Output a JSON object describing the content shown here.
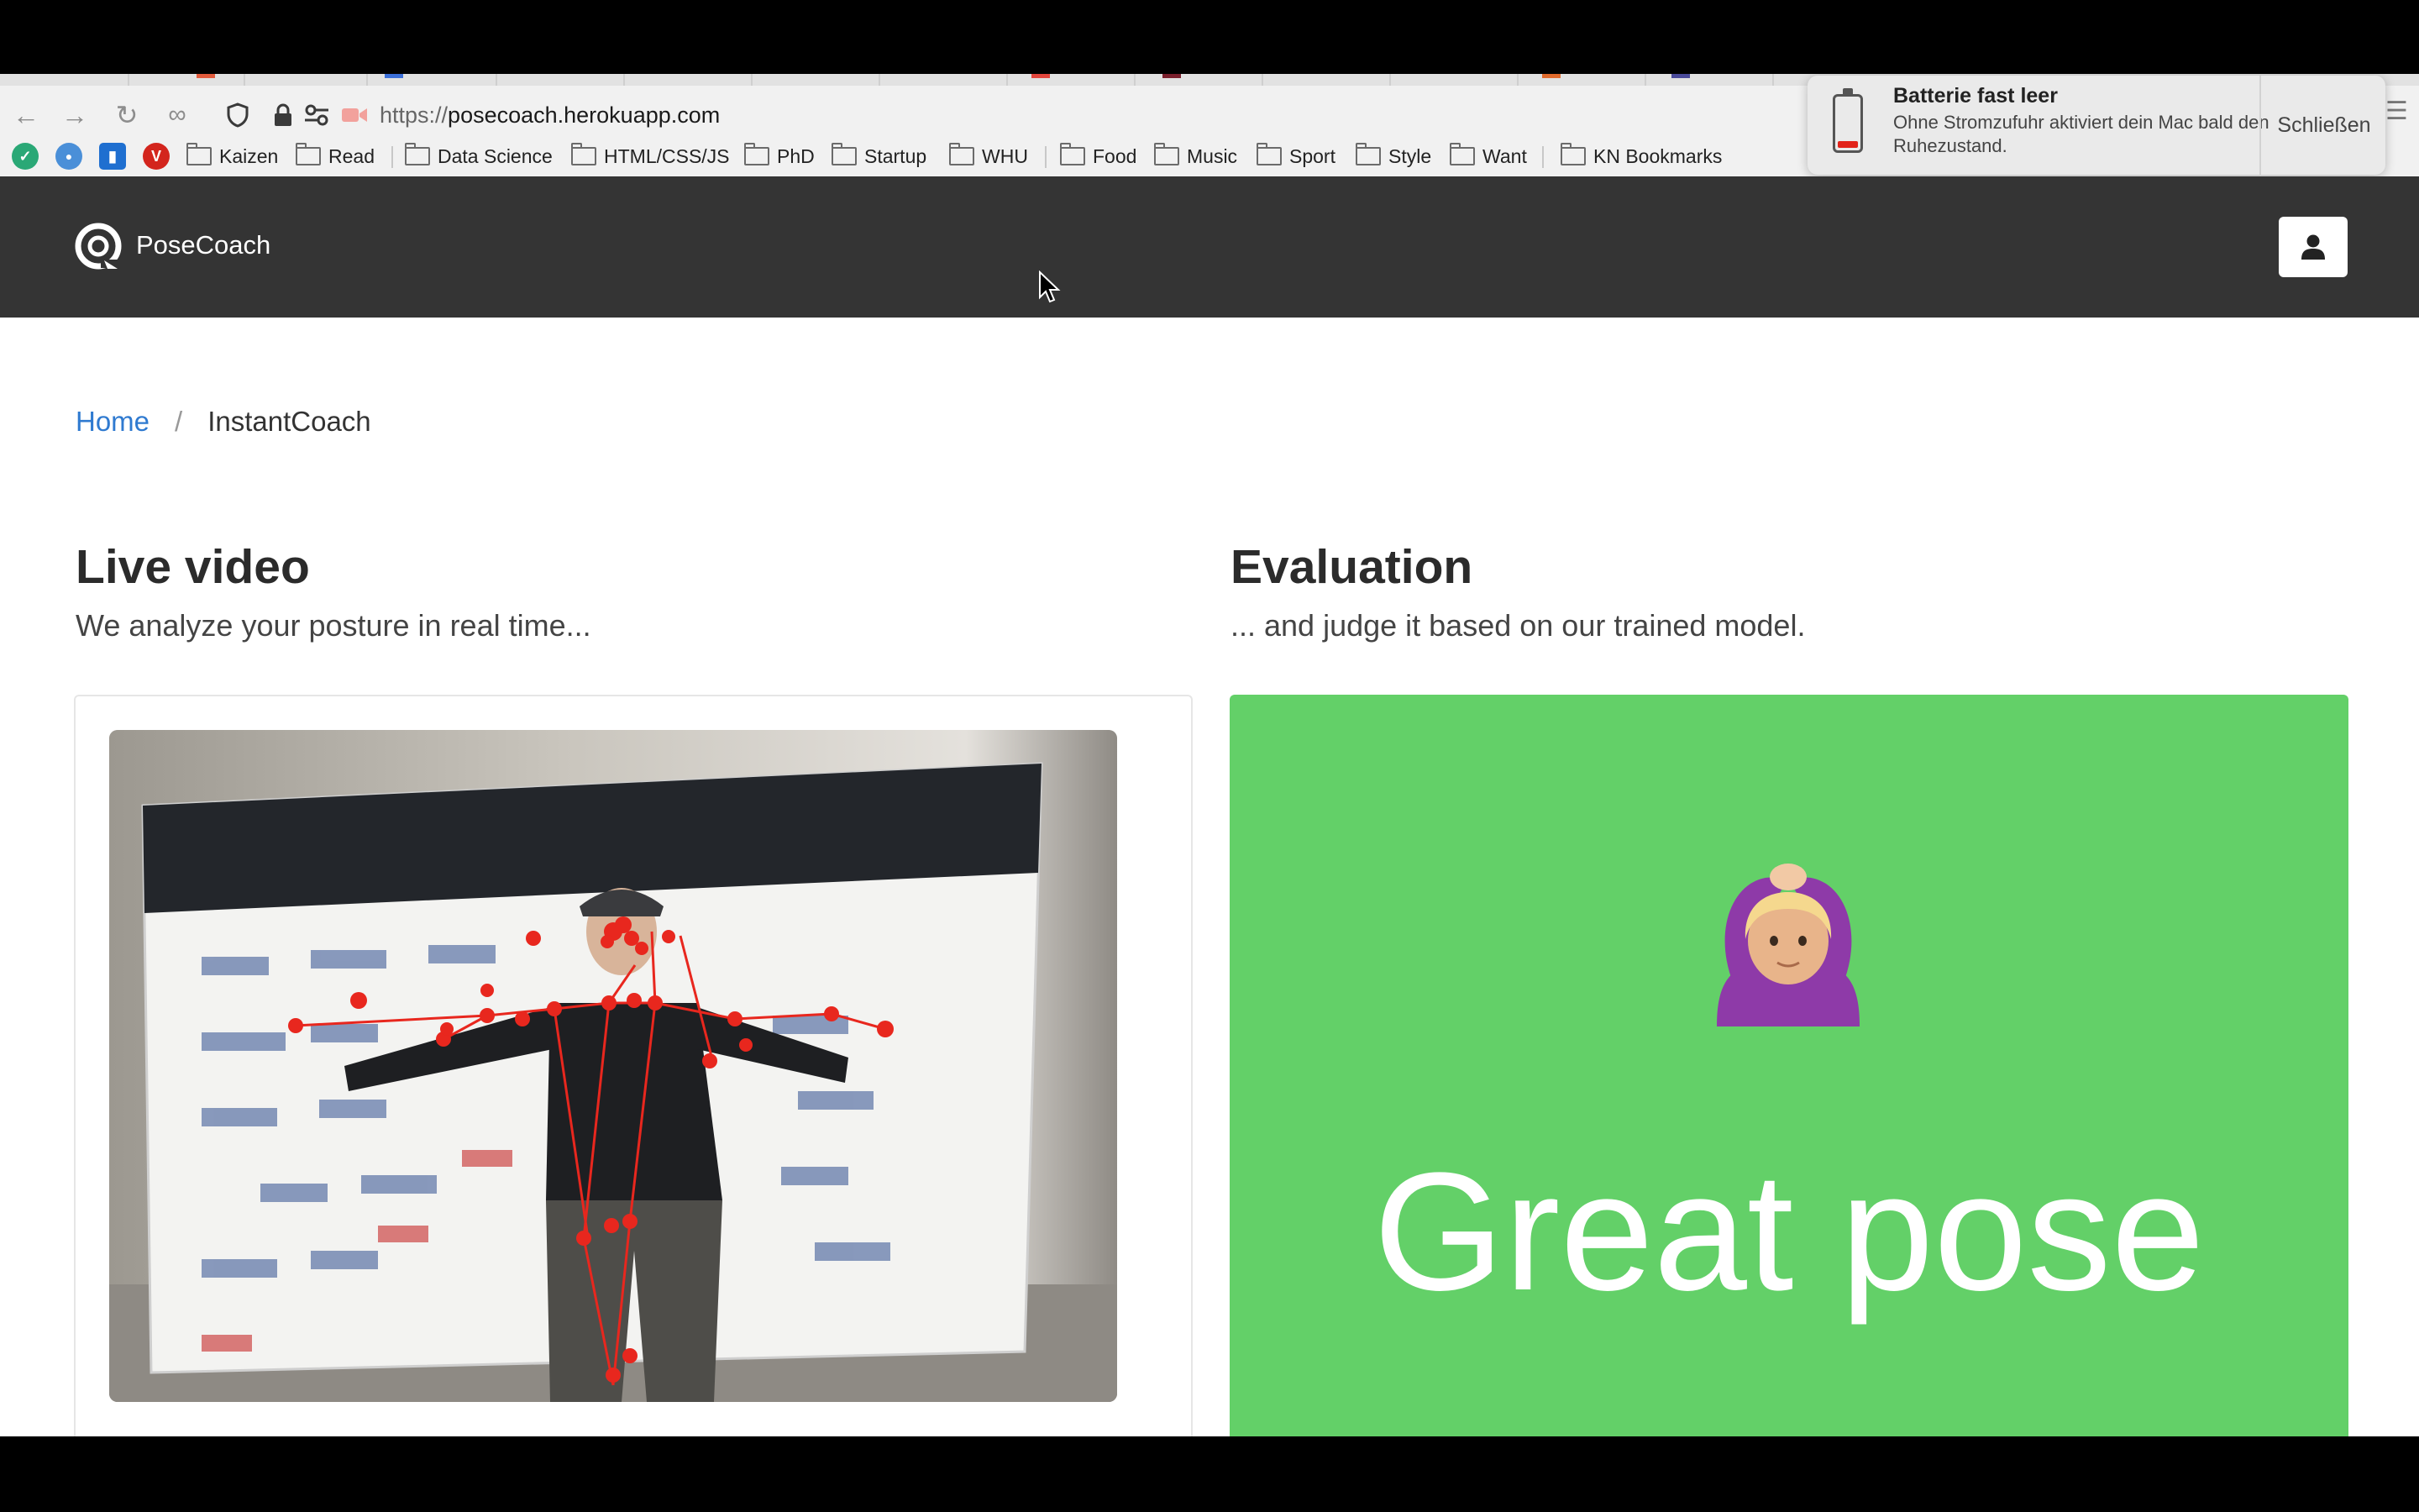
{
  "browser": {
    "url_prefix": "https://",
    "url_host": "posecoach.herokuapp.com",
    "bookmarks": [
      "Kaizen",
      "Read",
      "Data Science",
      "HTML/CSS/JS",
      "PhD",
      "Startup",
      "WHU",
      "Food",
      "Music",
      "Sport",
      "Style",
      "Want",
      "KN Bookmarks"
    ]
  },
  "notification": {
    "title": "Batterie fast leer",
    "message": "Ohne Stromzufuhr aktiviert dein Mac bald den Ruhezustand.",
    "close_label": "Schließen",
    "icon": "battery-low-icon"
  },
  "app": {
    "brand": "PoseCoach",
    "user_icon": "user-icon"
  },
  "breadcrumb": {
    "home": "Home",
    "separator": "/",
    "current": "InstantCoach"
  },
  "live": {
    "title": "Live video",
    "subtitle": "We analyze your posture in real time..."
  },
  "evaluation": {
    "title": "Evaluation",
    "subtitle": "... and judge it based on our trained model.",
    "verdict": "Great pose",
    "emoji": "person-gesturing-ok-icon",
    "color": "#63d068"
  },
  "colors": {
    "nav": "#343434",
    "link": "#2f7ad0",
    "skeleton": "#e8271e"
  }
}
